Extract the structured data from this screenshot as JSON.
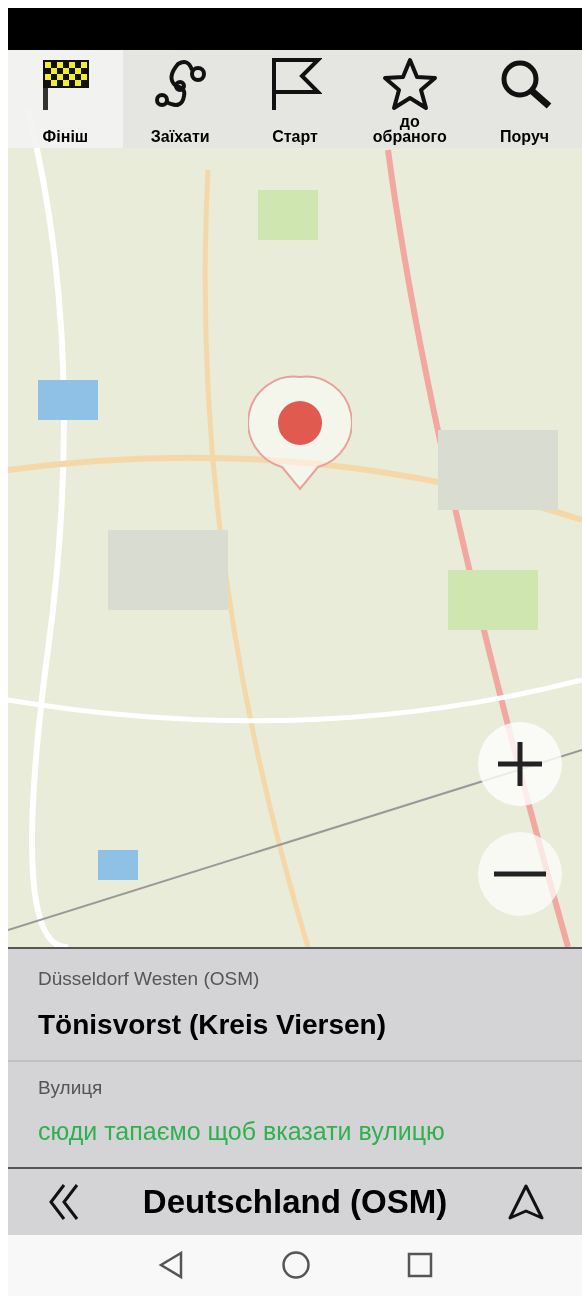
{
  "toolbar": [
    {
      "kind": "finish",
      "label": "Фініш",
      "selected": true
    },
    {
      "kind": "route",
      "label": "Заїхати",
      "selected": false
    },
    {
      "kind": "start",
      "label": "Старт",
      "selected": false
    },
    {
      "kind": "favorite",
      "label": "до обраного",
      "selected": false
    },
    {
      "kind": "search",
      "label": "Поруч",
      "selected": false
    }
  ],
  "info": {
    "map_source": "Düsseldorf Westen (OSM)",
    "place": "Tönisvorst (Kreis Viersen)",
    "street_label": "Вулиця",
    "street_hint": "сюди тапаємо щоб вказати вулицю"
  },
  "bottom_bar": {
    "title": "Deutschland (OSM)"
  }
}
